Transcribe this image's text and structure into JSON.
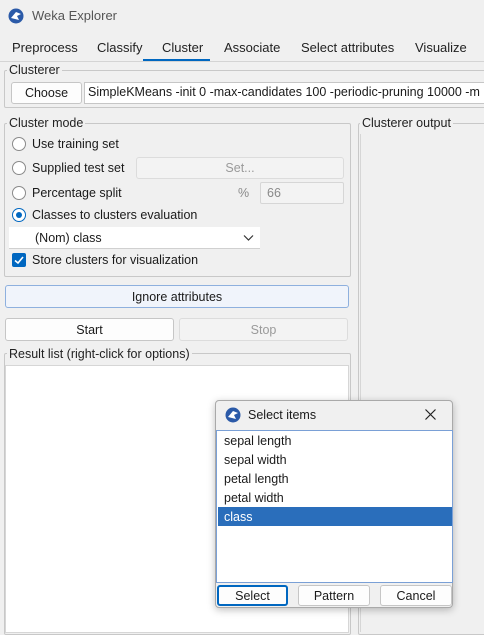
{
  "window": {
    "title": "Weka Explorer"
  },
  "tabs": [
    {
      "label": "Preprocess"
    },
    {
      "label": "Classify"
    },
    {
      "label": "Cluster"
    },
    {
      "label": "Associate"
    },
    {
      "label": "Select attributes"
    },
    {
      "label": "Visualize"
    }
  ],
  "active_tab": "Cluster",
  "clusterer": {
    "legend": "Clusterer",
    "choose_label": "Choose",
    "config": "SimpleKMeans -init 0 -max-candidates 100 -periodic-pruning 10000 -m"
  },
  "cluster_mode": {
    "legend": "Cluster mode",
    "options": [
      {
        "label": "Use training set",
        "selected": false
      },
      {
        "label": "Supplied test set",
        "selected": false
      },
      {
        "label": "Percentage split",
        "selected": false
      },
      {
        "label": "Classes to clusters evaluation",
        "selected": true
      }
    ],
    "set_label": "Set...",
    "percent_symbol": "%",
    "percent_value": "66",
    "class_select": "(Nom) class",
    "store_clusters_label": "Store clusters for visualization",
    "store_clusters_checked": true
  },
  "ignore_attributes_label": "Ignore attributes",
  "start_label": "Start",
  "stop_label": "Stop",
  "result_list": {
    "legend": "Result list (right-click for options)"
  },
  "output": {
    "legend": "Clusterer output"
  },
  "dialog": {
    "title": "Select items",
    "items": [
      "sepal length",
      "sepal width",
      "petal length",
      "petal width",
      "class"
    ],
    "selected_index": 4,
    "select_label": "Select",
    "pattern_label": "Pattern",
    "cancel_label": "Cancel"
  },
  "colors": {
    "accent": "#0067c0",
    "selection": "#2a6ebb",
    "window_bg": "#f0f0f0"
  },
  "icons": [
    "weka-bird-icon",
    "chevron-down-icon",
    "close-icon",
    "checkbox-check-icon"
  ]
}
